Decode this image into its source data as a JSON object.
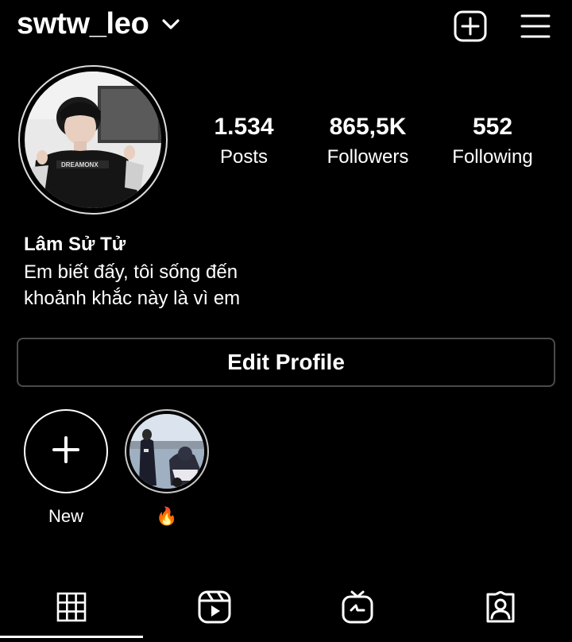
{
  "header": {
    "username": "swtw_leo",
    "dropdown_icon": "chevron-down-icon",
    "create_icon": "plus-square-icon",
    "menu_icon": "hamburger-menu-icon"
  },
  "stats": {
    "posts": {
      "value": "1.534",
      "label": "Posts"
    },
    "followers": {
      "value": "865,5K",
      "label": "Followers"
    },
    "following": {
      "value": "552",
      "label": "Following"
    }
  },
  "profile": {
    "name": "Lâm Sử Tử",
    "bio_line1": "Em biết đấy, tôi sống đến",
    "bio_line2": "khoảnh khắc này là vì em"
  },
  "edit_profile_label": "Edit Profile",
  "highlights": [
    {
      "label": "New",
      "icon": "plus-icon"
    },
    {
      "label": "🔥",
      "icon": "story-highlight-thumbnail"
    }
  ],
  "tabs": [
    {
      "name": "grid",
      "icon": "grid-icon",
      "active": true
    },
    {
      "name": "reels",
      "icon": "reels-icon",
      "active": false
    },
    {
      "name": "igtv",
      "icon": "igtv-icon",
      "active": false
    },
    {
      "name": "tagged",
      "icon": "tagged-person-icon",
      "active": false
    }
  ],
  "colors": {
    "background": "#000000",
    "text": "#ffffff",
    "border": "#4a4a4a"
  }
}
